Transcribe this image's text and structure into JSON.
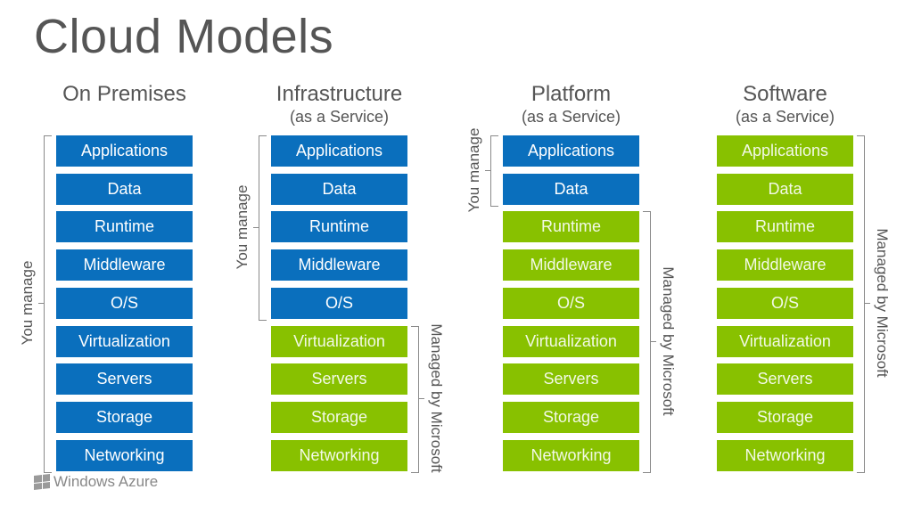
{
  "title": "Cloud Models",
  "colors": {
    "you_manage": "#0a6fbd",
    "managed_by_provider": "#88c100"
  },
  "models": [
    {
      "name": "On Premises",
      "subtitle": "",
      "you_manage_label": "You manage",
      "managed_label": "",
      "layers": [
        {
          "label": "Applications",
          "managed_by": "you"
        },
        {
          "label": "Data",
          "managed_by": "you"
        },
        {
          "label": "Runtime",
          "managed_by": "you"
        },
        {
          "label": "Middleware",
          "managed_by": "you"
        },
        {
          "label": "O/S",
          "managed_by": "you"
        },
        {
          "label": "Virtualization",
          "managed_by": "you"
        },
        {
          "label": "Servers",
          "managed_by": "you"
        },
        {
          "label": "Storage",
          "managed_by": "you"
        },
        {
          "label": "Networking",
          "managed_by": "you"
        }
      ]
    },
    {
      "name": "Infrastructure",
      "subtitle": "(as a Service)",
      "you_manage_label": "You manage",
      "managed_label": "Managed by Microsoft",
      "layers": [
        {
          "label": "Applications",
          "managed_by": "you"
        },
        {
          "label": "Data",
          "managed_by": "you"
        },
        {
          "label": "Runtime",
          "managed_by": "you"
        },
        {
          "label": "Middleware",
          "managed_by": "you"
        },
        {
          "label": "O/S",
          "managed_by": "you"
        },
        {
          "label": "Virtualization",
          "managed_by": "microsoft"
        },
        {
          "label": "Servers",
          "managed_by": "microsoft"
        },
        {
          "label": "Storage",
          "managed_by": "microsoft"
        },
        {
          "label": "Networking",
          "managed_by": "microsoft"
        }
      ]
    },
    {
      "name": "Platform",
      "subtitle": "(as a Service)",
      "you_manage_label": "You manage",
      "managed_label": "Managed by Microsoft",
      "layers": [
        {
          "label": "Applications",
          "managed_by": "you"
        },
        {
          "label": "Data",
          "managed_by": "you"
        },
        {
          "label": "Runtime",
          "managed_by": "microsoft"
        },
        {
          "label": "Middleware",
          "managed_by": "microsoft"
        },
        {
          "label": "O/S",
          "managed_by": "microsoft"
        },
        {
          "label": "Virtualization",
          "managed_by": "microsoft"
        },
        {
          "label": "Servers",
          "managed_by": "microsoft"
        },
        {
          "label": "Storage",
          "managed_by": "microsoft"
        },
        {
          "label": "Networking",
          "managed_by": "microsoft"
        }
      ]
    },
    {
      "name": "Software",
      "subtitle": "(as a Service)",
      "you_manage_label": "",
      "managed_label": "Managed by Microsoft",
      "layers": [
        {
          "label": "Applications",
          "managed_by": "microsoft"
        },
        {
          "label": "Data",
          "managed_by": "microsoft"
        },
        {
          "label": "Runtime",
          "managed_by": "microsoft"
        },
        {
          "label": "Middleware",
          "managed_by": "microsoft"
        },
        {
          "label": "O/S",
          "managed_by": "microsoft"
        },
        {
          "label": "Virtualization",
          "managed_by": "microsoft"
        },
        {
          "label": "Servers",
          "managed_by": "microsoft"
        },
        {
          "label": "Storage",
          "managed_by": "microsoft"
        },
        {
          "label": "Networking",
          "managed_by": "microsoft"
        }
      ]
    }
  ],
  "footer": {
    "logo_icon": "windows-flag-icon",
    "logo_text": "Windows Azure"
  }
}
